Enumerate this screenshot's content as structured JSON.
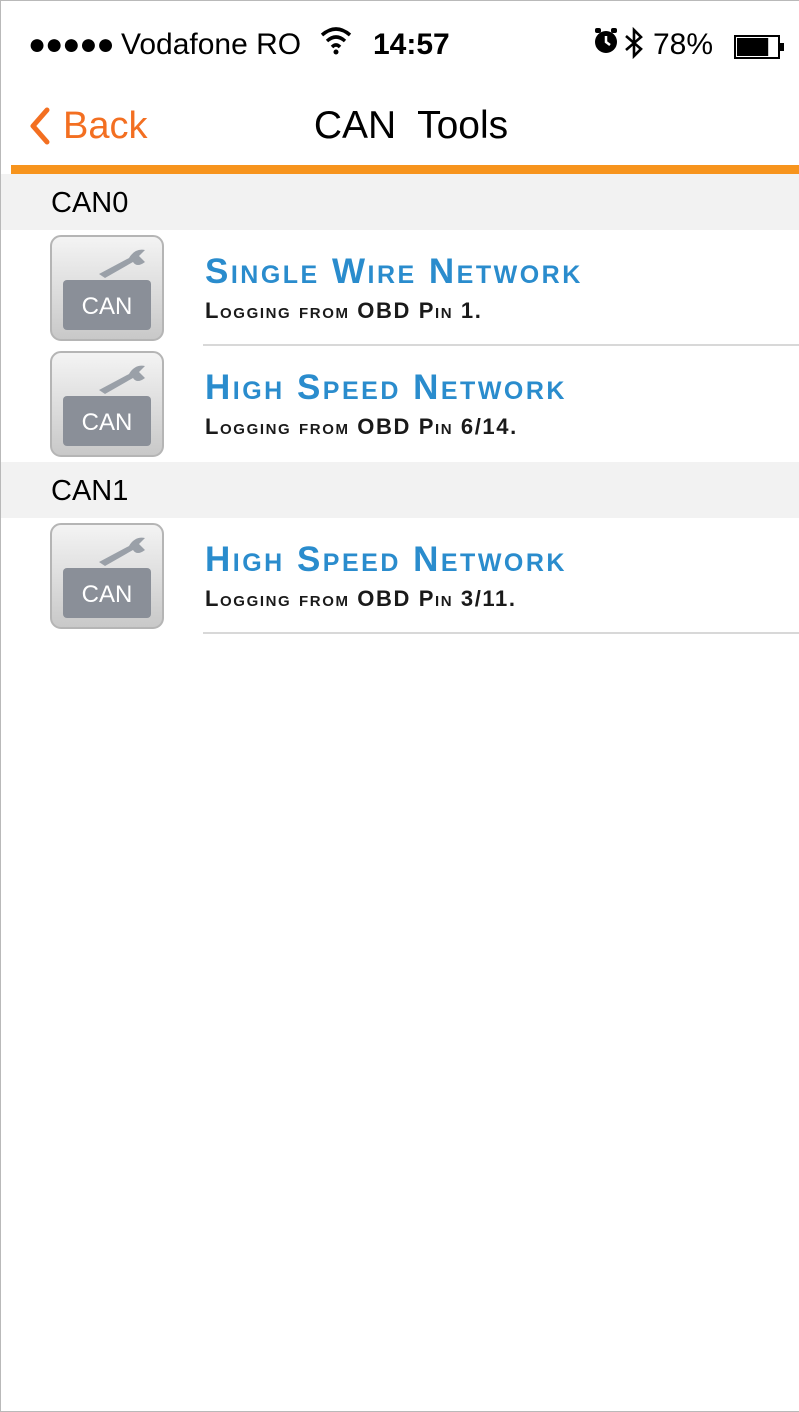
{
  "status_bar": {
    "signal": "●●●●●",
    "carrier": "Vodafone RO",
    "time": "14:57",
    "battery_percent": "78%",
    "battery_level": 0.78,
    "icons": [
      "wifi-icon",
      "alarm-icon",
      "bluetooth-icon",
      "battery-icon"
    ]
  },
  "nav": {
    "back_label": "Back",
    "title": "CAN  Tools"
  },
  "colors": {
    "accent": "#f36f21",
    "accent_line": "#f7941d",
    "link_blue": "#2a8ccd",
    "section_bg": "#f2f2f2"
  },
  "sections": [
    {
      "header": "CAN0",
      "items": [
        {
          "title": "Single Wire Network",
          "subtitle": "Logging from OBD Pin 1.",
          "icon": "can-tool-icon",
          "icon_text": "CAN"
        },
        {
          "title": "High Speed Network",
          "subtitle": "Logging from OBD Pin 6/14.",
          "icon": "can-tool-icon",
          "icon_text": "CAN"
        }
      ]
    },
    {
      "header": "CAN1",
      "items": [
        {
          "title": "High Speed Network",
          "subtitle": "Logging from OBD Pin 3/11.",
          "icon": "can-tool-icon",
          "icon_text": "CAN"
        }
      ]
    }
  ]
}
